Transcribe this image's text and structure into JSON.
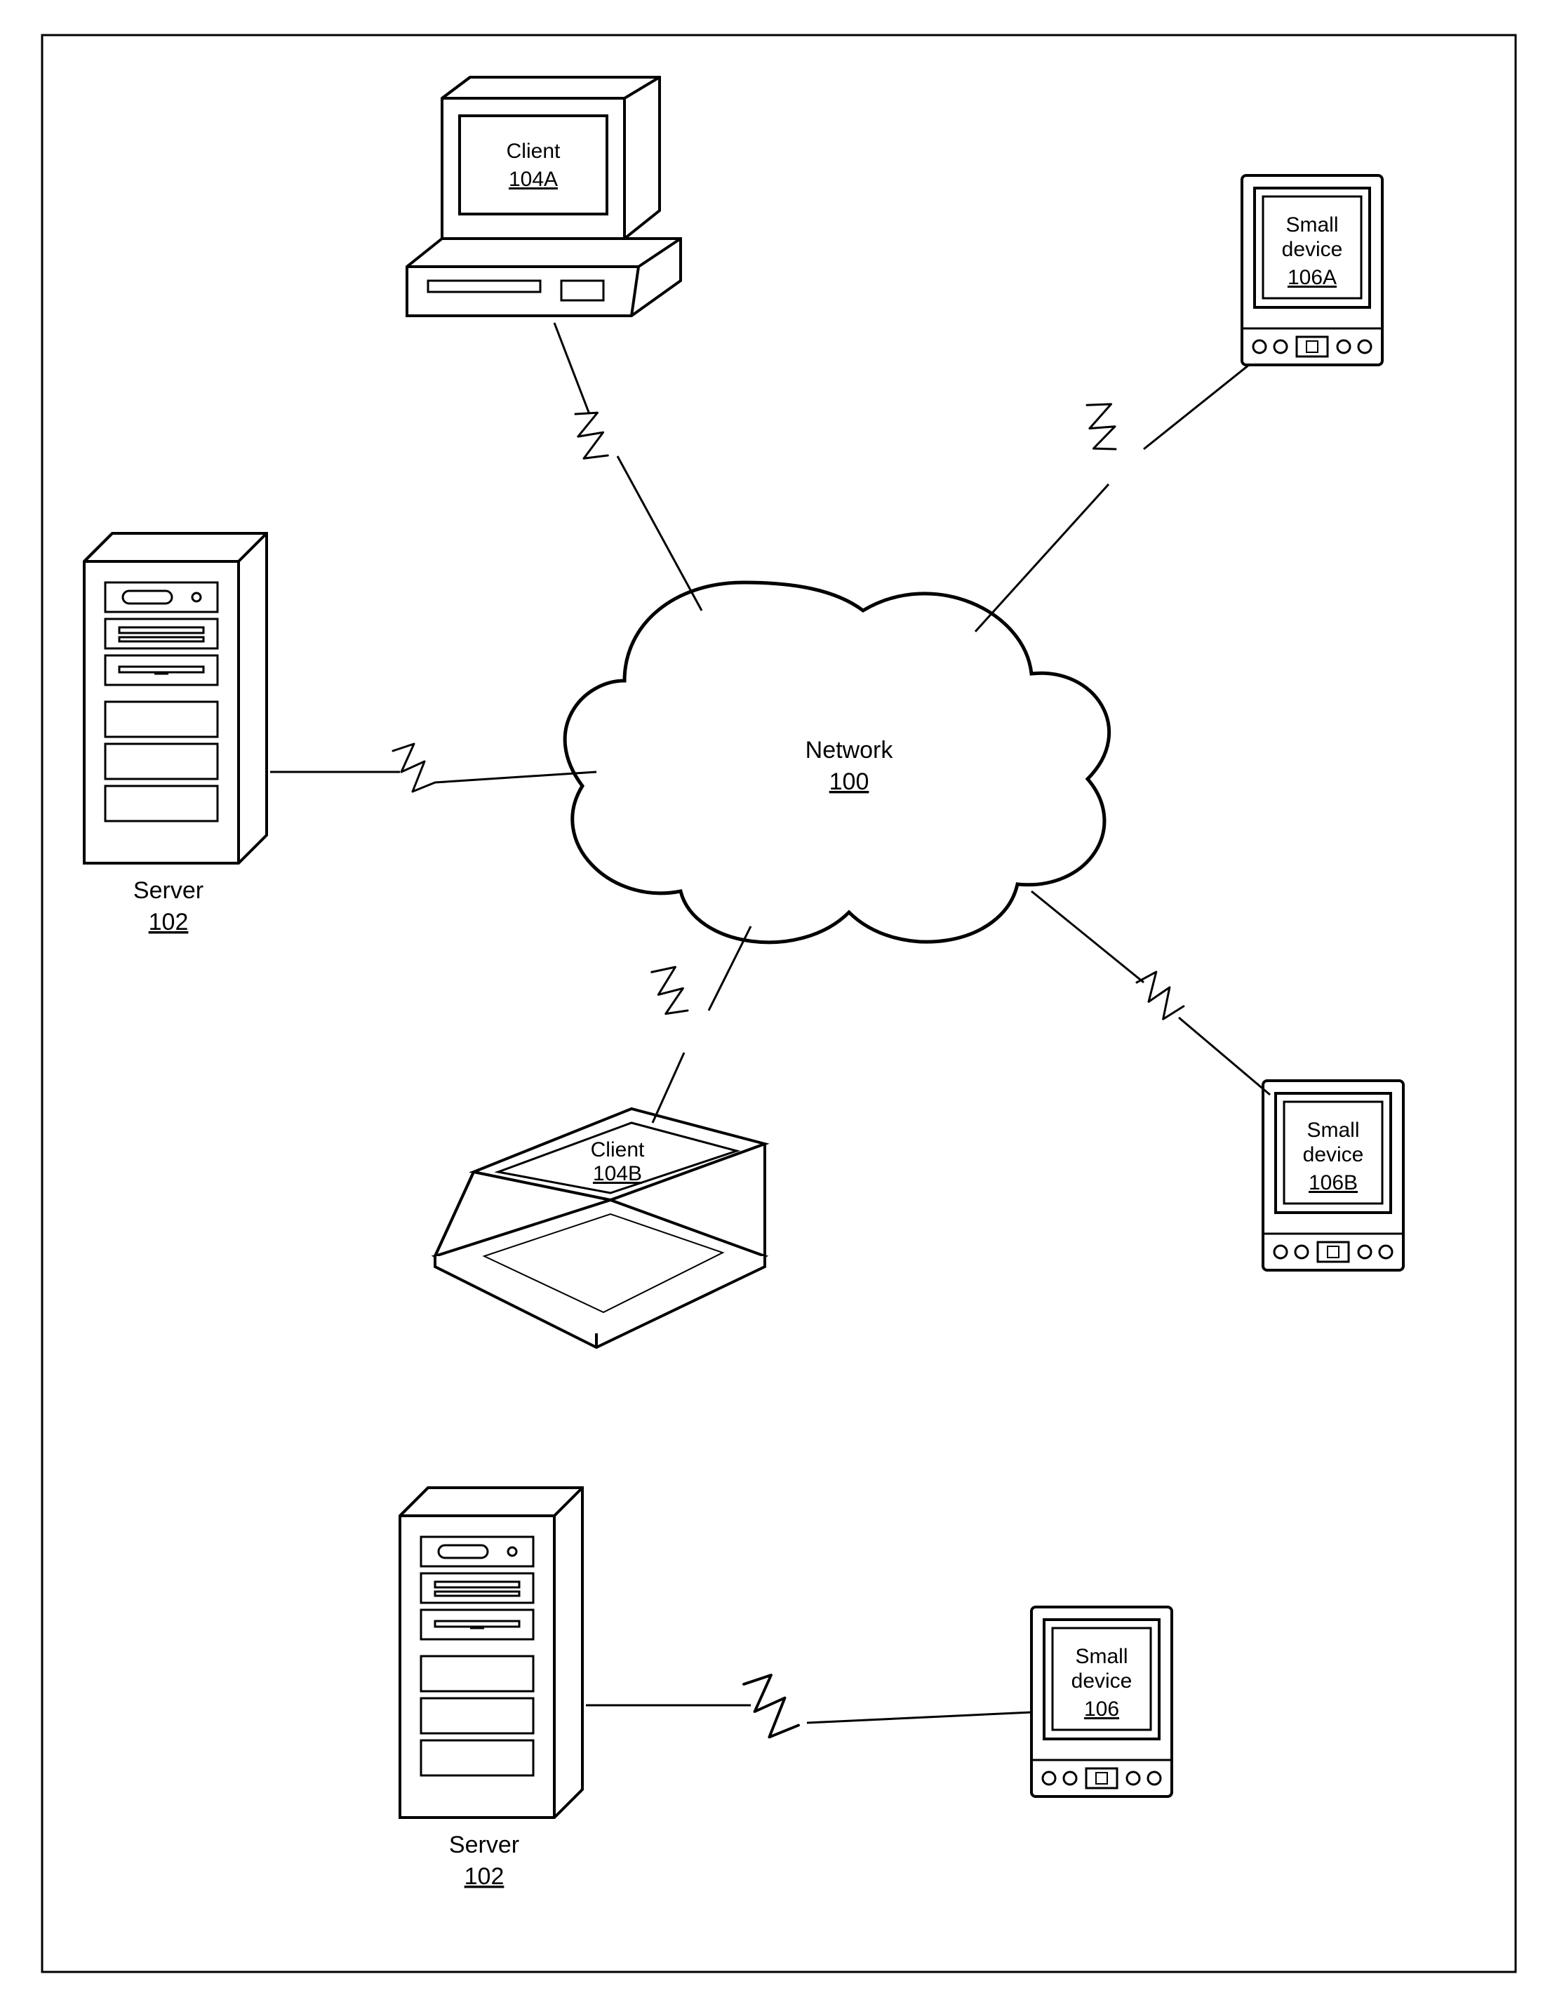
{
  "diagram": {
    "network": {
      "title": "Network",
      "id": "100"
    },
    "server": {
      "title": "Server",
      "id": "102"
    },
    "clientA": {
      "title": "Client",
      "id": "104A"
    },
    "clientB": {
      "title": "Client",
      "id": "104B"
    },
    "smallA": {
      "l1": "Small",
      "l2": "device",
      "id": "106A"
    },
    "smallB": {
      "l1": "Small",
      "l2": "device",
      "id": "106B"
    },
    "server2": {
      "title": "Server",
      "id": "102"
    },
    "small2": {
      "l1": "Small",
      "l2": "device",
      "id": "106"
    }
  }
}
